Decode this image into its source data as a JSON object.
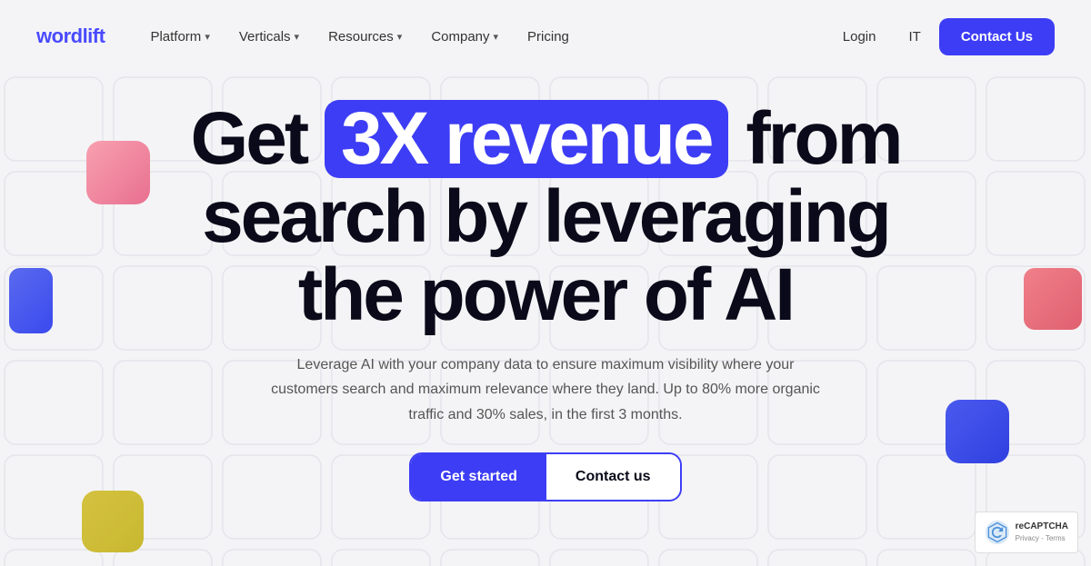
{
  "logo": {
    "text_w": "w",
    "text_rest": "ordlift"
  },
  "nav": {
    "links": [
      {
        "label": "Platform",
        "hasDropdown": true
      },
      {
        "label": "Verticals",
        "hasDropdown": true
      },
      {
        "label": "Resources",
        "hasDropdown": true
      },
      {
        "label": "Company",
        "hasDropdown": true
      },
      {
        "label": "Pricing",
        "hasDropdown": false
      }
    ],
    "login": "Login",
    "it": "IT",
    "contact_us": "Contact Us"
  },
  "hero": {
    "headline_before": "Get ",
    "headline_highlight": "3X revenue",
    "headline_after": " from search by leveraging the power of AI",
    "subheadline": "Leverage AI with your company data to ensure maximum visibility where your customers search and maximum relevance where they land. Up to 80% more organic traffic and 30% sales, in the first 3 months.",
    "cta_primary": "Get started",
    "cta_secondary": "Contact us"
  },
  "recaptcha": {
    "main": "reCAPTCHA",
    "links": "Privacy - Terms"
  },
  "colors": {
    "accent": "#3d3df5",
    "bg": "#f4f4f6"
  }
}
